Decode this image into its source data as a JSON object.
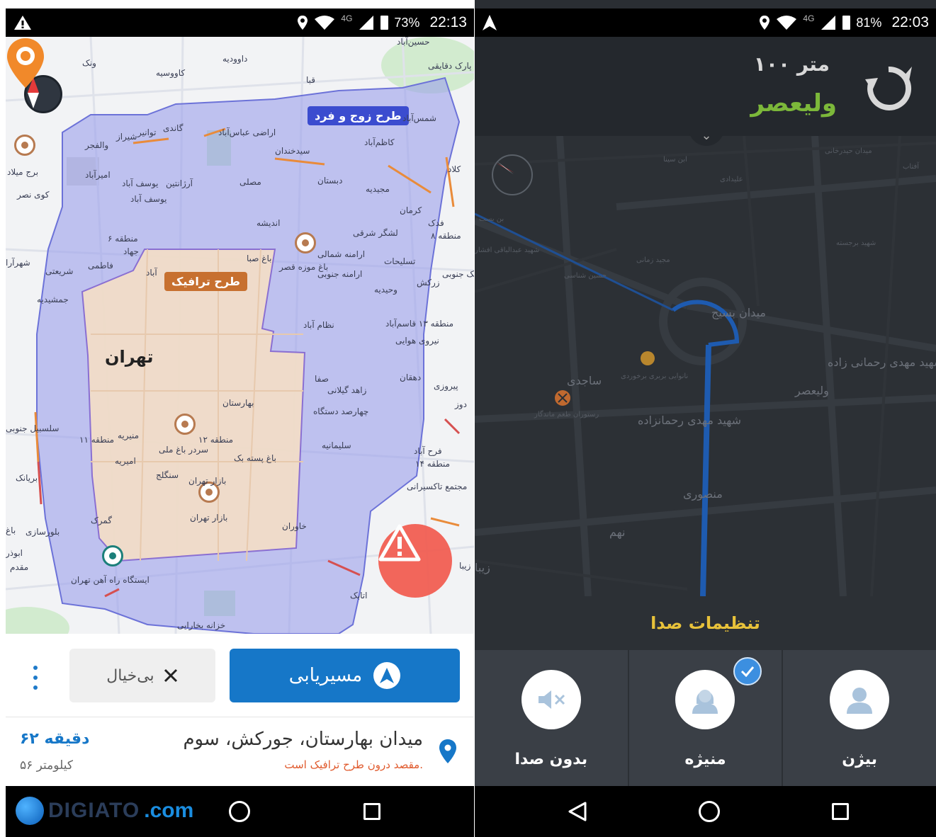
{
  "left": {
    "status": {
      "network": "4G",
      "battery": "73%",
      "time": "22:13"
    },
    "map": {
      "city": "تهران",
      "tag_odd_even": "طرح زوج و فرد",
      "tag_traffic": "طرح ترافیک",
      "labels": {
        "l1": "ونک",
        "l2": "داوودیه",
        "l3": "کاووسیه",
        "l4": "قبا",
        "l5": "حسین‌آباد",
        "l6": "پارک دقایقی",
        "l7": "گاندی",
        "l8": "توانیر",
        "l9": "شیراز",
        "l10": "والفجر",
        "l11": "اراضی عباس‌آباد",
        "l12": "شمس‌آباد",
        "l13": "کاظم‌آباد",
        "l14": "سیدخندان",
        "l15": "برج میلاد",
        "l16": "امیرآباد",
        "l17": "کوی نصر",
        "l18": "آرژانتین",
        "l19": "یوسف آباد",
        "l20": "مصلی",
        "l21": "دبستان",
        "l22": "مجیدیه",
        "l23": "کلاد",
        "l24": "یوسف آباد",
        "l25": "اندیشه",
        "l26": "کرمان",
        "l27": "منطقه ۶",
        "l28": "جهاد",
        "l29": "لشگر شرقی",
        "l30": "فدک",
        "l31": "منطقه ۸",
        "l32": "شهرآرا",
        "l33": "فاطمی",
        "l34": "شریعتی",
        "l35": "باغ صبا",
        "l36": "ارامنه شمالی",
        "l37": "تسلیحات",
        "l38": "باغ موزه قصر",
        "l39": "ارامنه جنوبی",
        "l40": "نارمک جنوبی",
        "l41": "آباد",
        "l42": "زرکش",
        "l43": "جمشیدیه",
        "l44": "وحیدیه",
        "l45": "نظام آباد",
        "l46": "منطقه ۱۳ قاسم‌آباد",
        "l47": "نیروی هوایی",
        "l48": "صفا",
        "l49": "دهقان",
        "l50": "پیروزی",
        "l51": "بهارستان",
        "l52": "زاهد گیلانی",
        "l53": "چهارصد دستگاه",
        "l54": "دوز",
        "l55": "سلسبیل جنوبی",
        "l56": "منطقه ۱۱",
        "l57": "منیریه",
        "l58": "منطقه ۱۲",
        "l59": "سردر باغ ملی",
        "l60": "سلیمانیه",
        "l61": "امیریه",
        "l62": "باغ پسته بک",
        "l63": "فرح آباد",
        "l64": "منطقه ۱۴",
        "l65": "سنگلج",
        "l66": "بازار تهران",
        "l67": "بریانک",
        "l68": "مجتمع تاکسیرانی",
        "l69": "گمرک",
        "l70": "بازار تهران",
        "l71": "خاوران",
        "l72": "بلورسازی",
        "l73": "باغ",
        "l74": "ایستگاه راه آهن تهران",
        "l75": "اتابک",
        "l76": "خزانه بخارایی",
        "l77": "زیبا",
        "l78": "مقدم",
        "l79": "ابوذر"
      }
    },
    "actions": {
      "route_label": "مسیریابی",
      "ignore_label": "بی‌خیال"
    },
    "destination": {
      "title": "میدان بهارستان، جورکش، سوم",
      "note": "مقصد درون طرح ترافیک است.",
      "time": "۶۲ دقیقه",
      "distance": "۵۶ کیلومتر"
    },
    "watermark": {
      "part1": "DIGIATO",
      "part2": ".com"
    }
  },
  "right": {
    "status": {
      "network": "4G",
      "battery": "81%",
      "time": "22:03"
    },
    "instruction": {
      "distance": "۱۰۰ متر",
      "street": "ولیعصر"
    },
    "map": {
      "labels": {
        "m1": "میدان بسیج",
        "m2": "شهید مهدی رحمانی زاده",
        "m3": "ولیعصر",
        "m4": "ساجدی",
        "m5": "شهید مهدی رحمانزاده",
        "m6": "منصوری",
        "m7": "نهم",
        "m8": "زیبا",
        "m9": "شهید عبدالباقی افشار",
        "m10": "حسین شناسی",
        "m11": "مجید زمانی",
        "m12": "شهید برجسته",
        "m13": "بن بست",
        "m14": "نانوایی بربری برخوردی",
        "m15": "رستوران طعم ماندگار",
        "m16": "میدان حیدرخانی",
        "m17": "علیدادی",
        "m18": "ابن سینا",
        "m19": "آفتاب"
      }
    },
    "sound": {
      "title": "تنظیمات صدا",
      "options": [
        {
          "label": "بیژن",
          "selected": false
        },
        {
          "label": "منیژه",
          "selected": true
        },
        {
          "label": "بدون صدا",
          "selected": false
        }
      ]
    }
  }
}
